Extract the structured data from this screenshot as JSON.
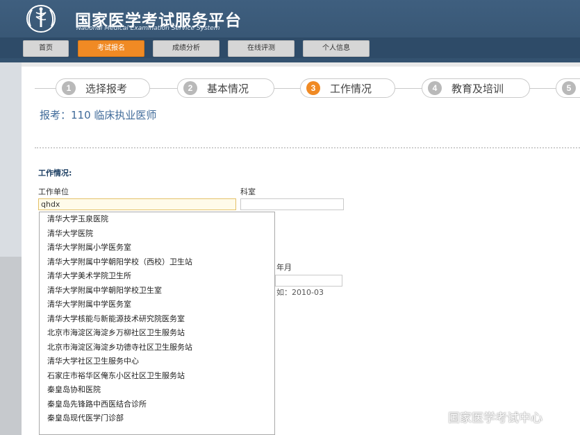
{
  "header": {
    "title": "国家医学考试服务平台",
    "subtitle": "National Medical Examination Service System"
  },
  "nav": [
    {
      "label": "首页"
    },
    {
      "label": "考试报名",
      "active": true
    },
    {
      "label": "成绩分析"
    },
    {
      "label": "在线评测"
    },
    {
      "label": "个人信息"
    }
  ],
  "steps": [
    {
      "num": "1",
      "label": "选择报考"
    },
    {
      "num": "2",
      "label": "基本情况"
    },
    {
      "num": "3",
      "label": "工作情况",
      "active": true
    },
    {
      "num": "4",
      "label": "教育及培训"
    },
    {
      "num": "5",
      "label": ""
    }
  ],
  "apply_title": "报考：110 临床执业医师",
  "form": {
    "section_title": "工作情况:",
    "work_unit_label": "工作单位",
    "work_unit_value": "qhdx",
    "department_label": "科室",
    "department_value": "",
    "partial_label": "年月",
    "partial_hint": "如：2010-03"
  },
  "dropdown": [
    "清华大学玉泉医院",
    "清华大学医院",
    "清华大学附属小学医务室",
    "清华大学附属中学朝阳学校（西校）卫生站",
    "清华大学美术学院卫生所",
    "清华大学附属中学朝阳学校卫生室",
    "清华大学附属中学医务室",
    "清华大学核能与新能源技术研究院医务室",
    "北京市海淀区海淀乡万柳社区卫生服务站",
    "北京市海淀区海淀乡功德寺社区卫生服务站",
    "清华大学社区卫生服务中心",
    "石家庄市裕华区俺东小区社区卫生服务站",
    "秦皇岛协和医院",
    "秦皇岛先锋路中西医结合诊所",
    "秦皇岛现代医学门诊部"
  ],
  "watermark": "国家医学考试中心",
  "colors": {
    "header_bg": "#3f5f7f",
    "accent": "#f08a24",
    "title_blue": "#3f6a99"
  }
}
